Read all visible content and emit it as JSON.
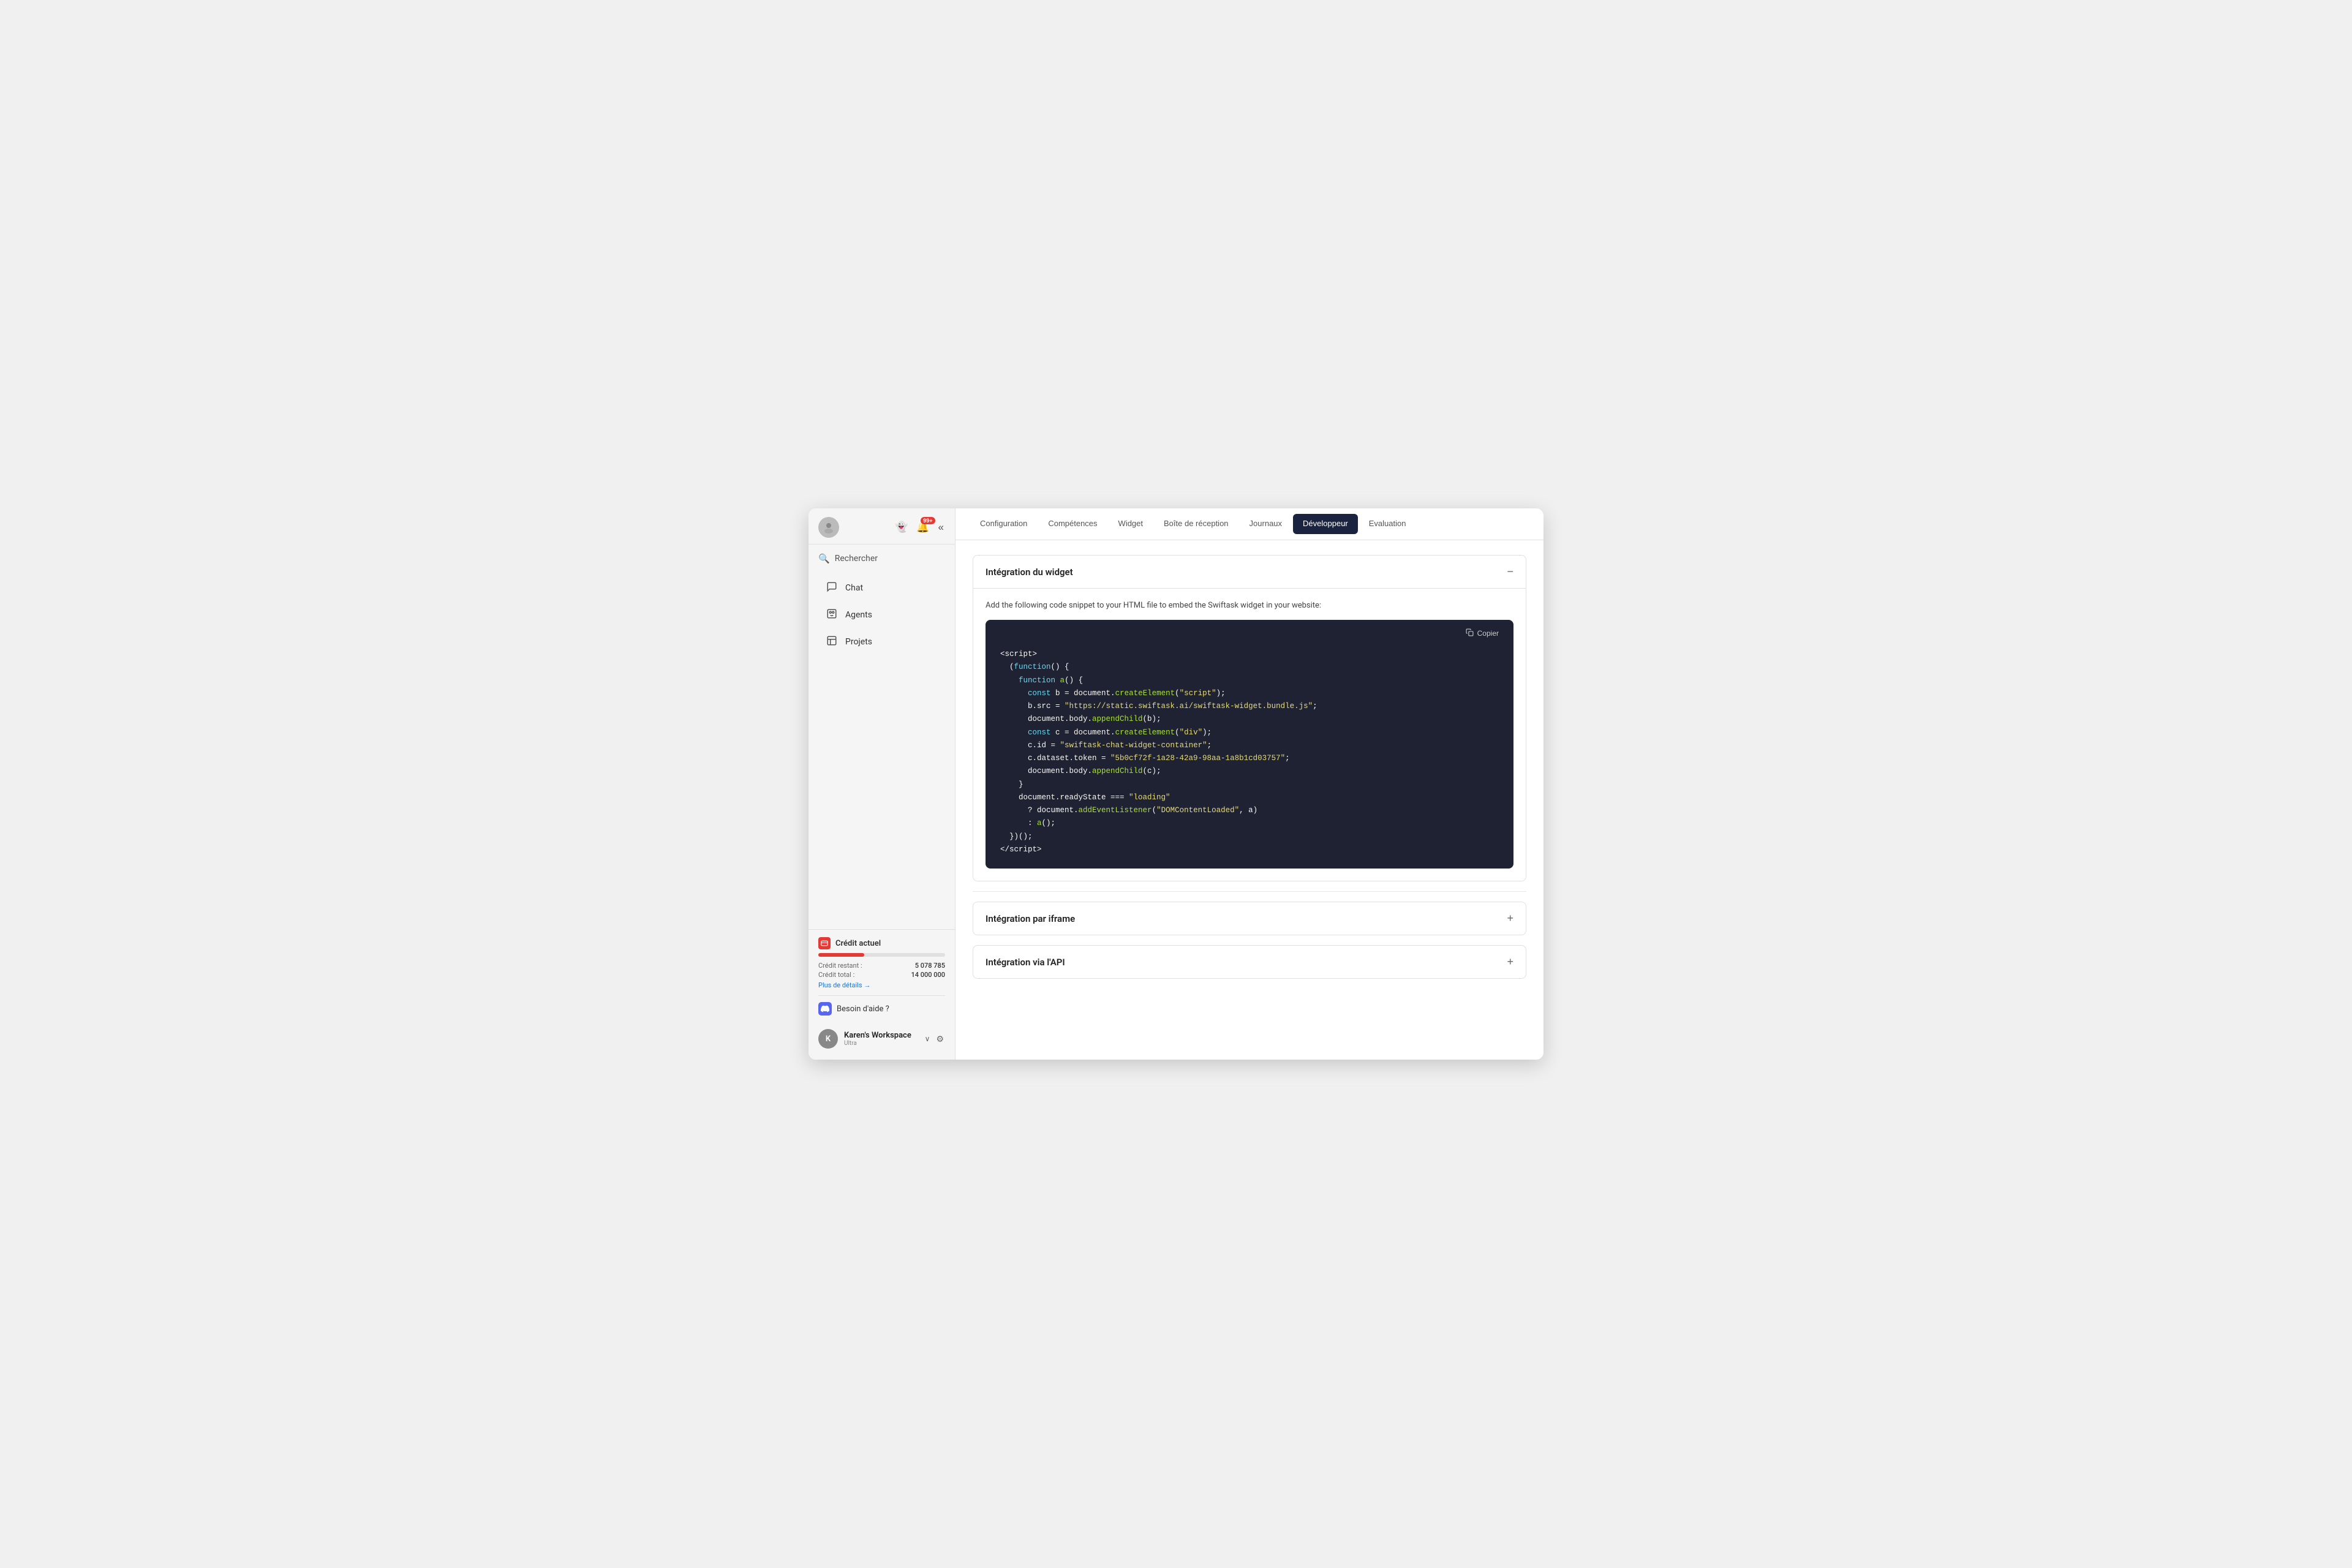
{
  "app": {
    "title": "Swiftask"
  },
  "sidebar": {
    "avatar_initial": "K",
    "notification_badge": "99+",
    "search_label": "Rechercher",
    "nav_items": [
      {
        "id": "chat",
        "label": "Chat",
        "icon": "💬"
      },
      {
        "id": "agents",
        "label": "Agents",
        "icon": "🤖"
      },
      {
        "id": "projects",
        "label": "Projets",
        "icon": "📄"
      }
    ],
    "credit": {
      "title": "Crédit actuel",
      "remaining_label": "Crédit restant :",
      "remaining_value": "5 078 785",
      "total_label": "Crédit total :",
      "total_value": "14 000 000",
      "details_link": "Plus de détails",
      "bar_percent": 36
    },
    "help": {
      "label": "Besoin d'aide ?"
    },
    "workspace": {
      "name": "Karen's Workspace",
      "plan": "Ultra",
      "initial": "K"
    }
  },
  "topnav": {
    "tabs": [
      {
        "id": "configuration",
        "label": "Configuration"
      },
      {
        "id": "competences",
        "label": "Compétences"
      },
      {
        "id": "widget",
        "label": "Widget"
      },
      {
        "id": "boite",
        "label": "Boîte de réception"
      },
      {
        "id": "journaux",
        "label": "Journaux"
      },
      {
        "id": "developpeur",
        "label": "Développeur",
        "active": true
      },
      {
        "id": "evaluation",
        "label": "Evaluation"
      }
    ]
  },
  "main": {
    "widget_integration": {
      "title": "Intégration du widget",
      "description": "Add the following code snippet to your HTML file to embed the Swiftask widget in your website:",
      "copy_label": "Copier",
      "code_token": "5b0cf72f-1a28-42a9-98aa-1a8b1cd03757"
    },
    "iframe_integration": {
      "title": "Intégration par iframe"
    },
    "api_integration": {
      "title": "Intégration via l'API"
    }
  }
}
